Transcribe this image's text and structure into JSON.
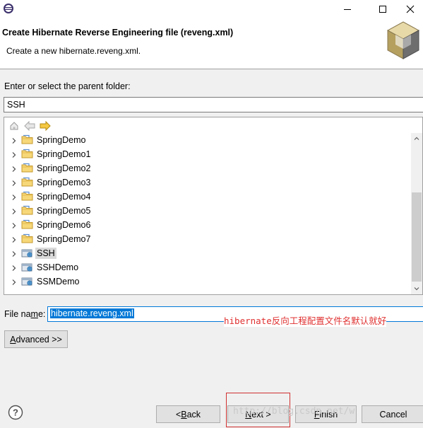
{
  "header": {
    "title": "Create Hibernate Reverse Engineering file (reveng.xml)",
    "description": "Create a new hibernate.reveng.xml."
  },
  "parent_folder": {
    "label": "Enter or select the parent folder:",
    "value": "SSH"
  },
  "tree": {
    "items": [
      {
        "label": "SpringDemo",
        "icon": "folder-icon",
        "selected": false
      },
      {
        "label": "SpringDemo1",
        "icon": "folder-icon",
        "selected": false
      },
      {
        "label": "SpringDemo2",
        "icon": "folder-icon",
        "selected": false
      },
      {
        "label": "SpringDemo3",
        "icon": "folder-icon",
        "selected": false
      },
      {
        "label": "SpringDemo4",
        "icon": "folder-icon",
        "selected": false
      },
      {
        "label": "SpringDemo5",
        "icon": "folder-icon",
        "selected": false
      },
      {
        "label": "SpringDemo6",
        "icon": "folder-icon",
        "selected": false
      },
      {
        "label": "SpringDemo7",
        "icon": "folder-icon",
        "selected": false
      },
      {
        "label": "SSH",
        "icon": "web-project-icon",
        "selected": true
      },
      {
        "label": "SSHDemo",
        "icon": "web-project-icon",
        "selected": false
      },
      {
        "label": "SSMDemo",
        "icon": "web-project-icon",
        "selected": false
      }
    ]
  },
  "file_name": {
    "label_pre": "File na",
    "label_mnemonic": "m",
    "label_post": "e:",
    "value": "hibernate.reveng.xml"
  },
  "annotation": "hibernate反向工程配置文件名默认就好",
  "buttons": {
    "advanced_mnemonic": "A",
    "advanced_rest": "dvanced >>",
    "back_pre": "< ",
    "back_mnemonic": "B",
    "back_rest": "ack",
    "next_mnemonic": "N",
    "next_rest": "ext >",
    "finish_mnemonic": "F",
    "finish_rest": "inish",
    "cancel": "Cancel"
  },
  "watermark": "http://blog.csdn.net/w",
  "colors": {
    "accent": "#0078d7",
    "annotation": "#e03030",
    "highlight_border": "#d03030"
  }
}
